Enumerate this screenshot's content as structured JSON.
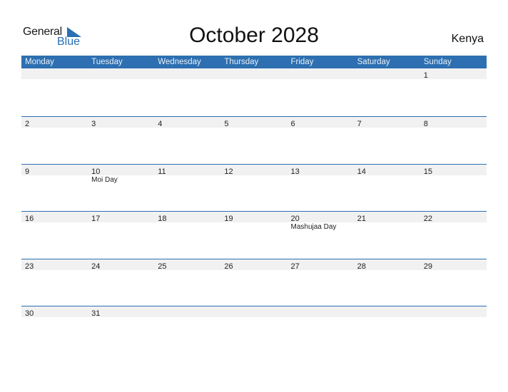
{
  "logo": {
    "line1": "General",
    "line2": "Blue",
    "brand_color": "#2a6fb5"
  },
  "title": "October 2028",
  "country": "Kenya",
  "header_color": "#2d6fb1",
  "weekdays": [
    "Monday",
    "Tuesday",
    "Wednesday",
    "Thursday",
    "Friday",
    "Saturday",
    "Sunday"
  ],
  "weeks": [
    [
      {
        "d": ""
      },
      {
        "d": ""
      },
      {
        "d": ""
      },
      {
        "d": ""
      },
      {
        "d": ""
      },
      {
        "d": ""
      },
      {
        "d": "1"
      }
    ],
    [
      {
        "d": "2"
      },
      {
        "d": "3"
      },
      {
        "d": "4"
      },
      {
        "d": "5"
      },
      {
        "d": "6"
      },
      {
        "d": "7"
      },
      {
        "d": "8"
      }
    ],
    [
      {
        "d": "9"
      },
      {
        "d": "10",
        "h": "Moi Day"
      },
      {
        "d": "11"
      },
      {
        "d": "12"
      },
      {
        "d": "13"
      },
      {
        "d": "14"
      },
      {
        "d": "15"
      }
    ],
    [
      {
        "d": "16"
      },
      {
        "d": "17"
      },
      {
        "d": "18"
      },
      {
        "d": "19"
      },
      {
        "d": "20",
        "h": "Mashujaa Day"
      },
      {
        "d": "21"
      },
      {
        "d": "22"
      }
    ],
    [
      {
        "d": "23"
      },
      {
        "d": "24"
      },
      {
        "d": "25"
      },
      {
        "d": "26"
      },
      {
        "d": "27"
      },
      {
        "d": "28"
      },
      {
        "d": "29"
      }
    ],
    [
      {
        "d": "30"
      },
      {
        "d": "31"
      },
      {
        "d": ""
      },
      {
        "d": ""
      },
      {
        "d": ""
      },
      {
        "d": ""
      },
      {
        "d": ""
      }
    ]
  ]
}
